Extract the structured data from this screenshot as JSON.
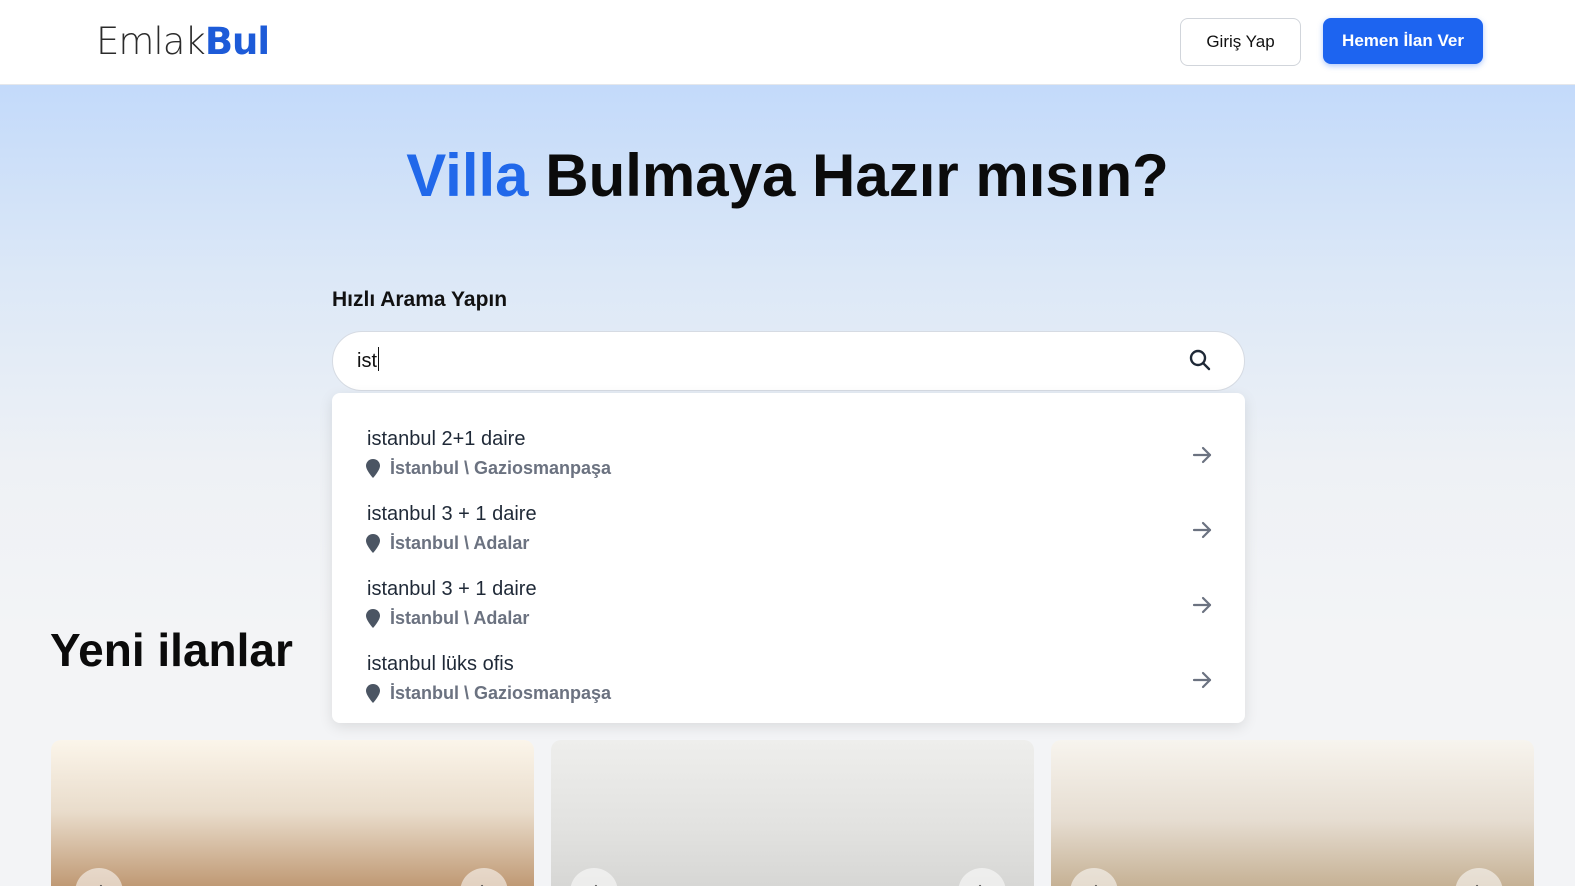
{
  "header": {
    "logo_part1": "Emlak",
    "logo_part2": "Bul",
    "login_label": "Giriş Yap",
    "post_label": "Hemen İlan Ver"
  },
  "hero": {
    "title_accent": "Villa",
    "title_rest": " Bulmaya Hazır mısın?",
    "search_label": "Hızlı Arama Yapın",
    "search_value": "ist"
  },
  "suggestions": [
    {
      "title": "istanbul 2+1 daire",
      "location": "İstanbul \\ Gaziosmanpaşa"
    },
    {
      "title": "istanbul 3 + 1 daire",
      "location": "İstanbul \\ Adalar"
    },
    {
      "title": "istanbul 3 + 1 daire",
      "location": "İstanbul \\ Adalar"
    },
    {
      "title": "istanbul lüks ofis",
      "location": "İstanbul \\ Gaziosmanpaşa"
    }
  ],
  "listings": {
    "section_title": "Yeni ilanlar"
  },
  "colors": {
    "brand_blue": "#1d64f0",
    "accent_blue": "#2168ea",
    "muted_text": "#6b7280"
  },
  "icons": [
    "search-icon",
    "map-pin-icon",
    "arrow-right-icon",
    "chevron-left-icon",
    "chevron-right-icon"
  ]
}
